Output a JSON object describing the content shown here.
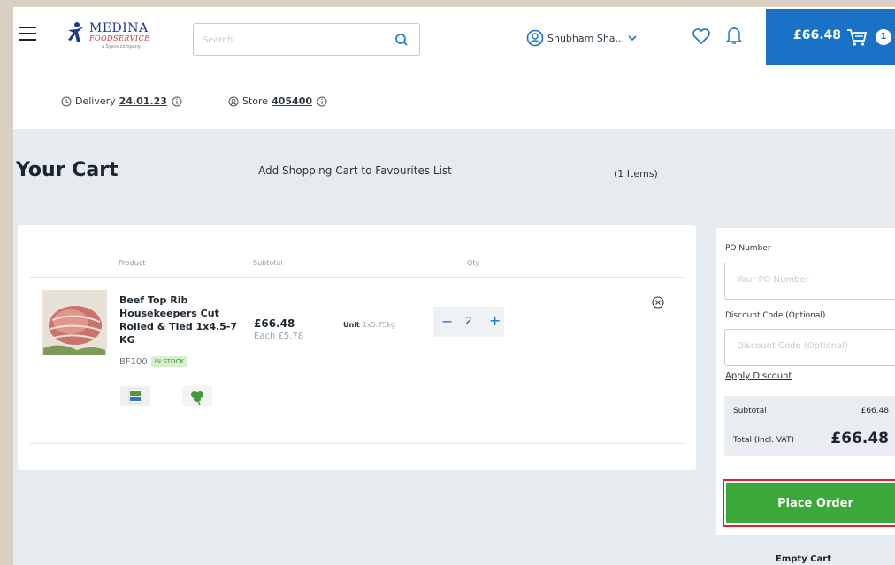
{
  "header": {
    "logo_name": "MEDINA",
    "logo_sub": "FOODSERVICE",
    "logo_tag": "a Sysco company",
    "search_placeholder": "Search",
    "user_name": "Shubham Sha...",
    "cart_total": "£66.48",
    "cart_count": "1"
  },
  "subbar": {
    "delivery_label": "Delivery",
    "delivery_date": "24.01.23",
    "store_label": "Store",
    "store_number": "405400"
  },
  "cart": {
    "title": "Your Cart",
    "favourites_link": "Add Shopping Cart to Favourites List",
    "item_count": "(1 Items)",
    "columns": {
      "product": "Product",
      "subtotal": "Subtotal",
      "qty": "Qty"
    },
    "items": [
      {
        "name": "Beef Top Rib Housekeepers Cut Rolled & Tied 1x4.5-7 KG",
        "code": "BF100",
        "stock": "IN STOCK",
        "subtotal": "£66.48",
        "each": "Each £5.78",
        "unit_label": "Unit",
        "unit_value": "1x5.75kg",
        "qty": "2"
      }
    ]
  },
  "sidebar": {
    "po_label": "PO Number",
    "po_placeholder": "Your PO Number",
    "discount_label": "Discount Code (Optional)",
    "discount_placeholder": "Discount Code (Optional)",
    "apply_label": "Apply Discount",
    "subtotal_label": "Subtotal",
    "subtotal_value": "£66.48",
    "total_label": "Total (Incl. VAT)",
    "total_value": "£66.48",
    "place_order": "Place Order",
    "empty_cart": "Empty Cart"
  },
  "colors": {
    "brand_blue": "#1a72c6",
    "order_green": "#3ba83a",
    "highlight_red": "#d7262d"
  }
}
